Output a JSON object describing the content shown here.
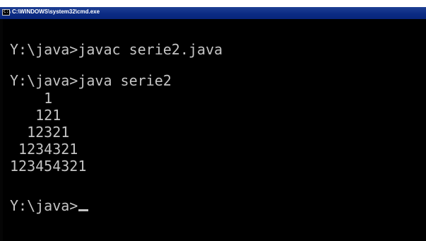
{
  "window": {
    "title": "C:\\WINDOWS\\system32\\cmd.exe",
    "icon": "cmd-icon",
    "icon_glyph": "C:\\"
  },
  "console": {
    "lines": [
      "Y:\\java>javac serie2.java",
      "",
      "Y:\\java>java serie2",
      "    1",
      "   121",
      "  12321",
      " 1234321",
      "123454321",
      "",
      "Y:\\java>"
    ],
    "cursor": "_"
  },
  "colors": {
    "background": "#000000",
    "text": "#c4c4c4",
    "titlebar": "#0b2b84",
    "title_text": "#ffffff"
  }
}
